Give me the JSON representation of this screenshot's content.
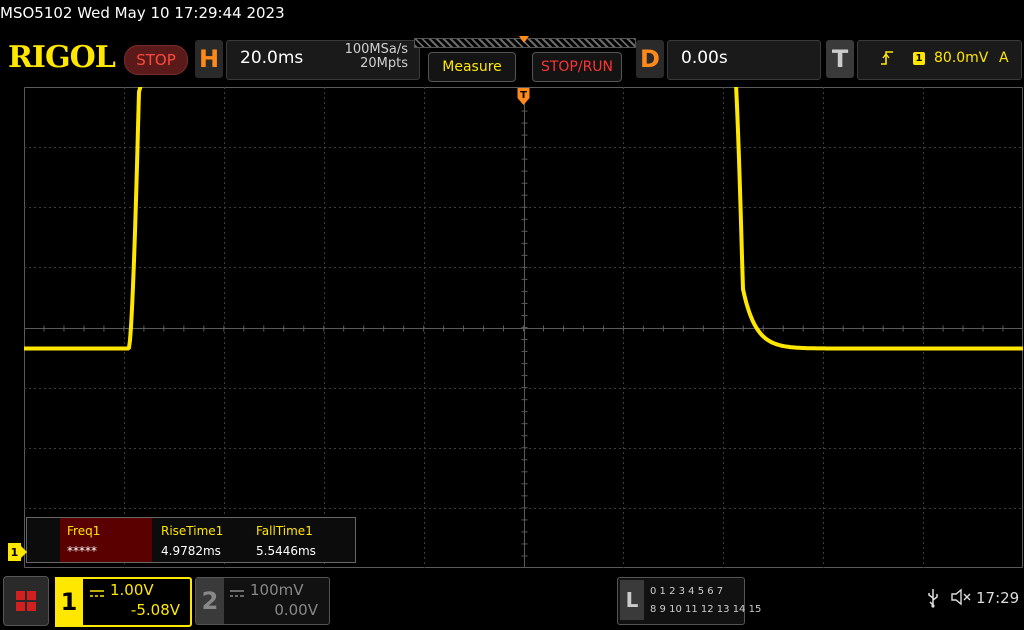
{
  "header": {
    "title_line": "MSO5102  Wed May 10 17:29:44 2023",
    "logo": "RIGOL",
    "run_state": "STOP"
  },
  "horizontal": {
    "letter": "H",
    "timebase": "20.0ms",
    "sample_rate": "100MSa/s",
    "memory_depth": "20Mpts"
  },
  "buttons": {
    "measure": "Measure",
    "stop_run": "STOP/RUN"
  },
  "delay": {
    "letter": "D",
    "value": "0.00s"
  },
  "trigger": {
    "letter": "T",
    "edge_icon": "rising-edge-icon",
    "source": "1",
    "level": "80.0mV",
    "mode": "A"
  },
  "measurements": {
    "headers": [
      "Freq1",
      "RiseTime1",
      "FallTime1"
    ],
    "values": [
      "*****",
      "4.9782ms",
      "5.5446ms"
    ]
  },
  "channels": {
    "ch1": {
      "number": "1",
      "coupling_icon": "dc-coupling-icon",
      "scale": "1.00V",
      "offset": "-5.08V",
      "color": "#ffe700"
    },
    "ch2": {
      "number": "2",
      "coupling_icon": "dc-coupling-icon",
      "scale": "100mV",
      "offset": "0.00V",
      "color": "#888888"
    }
  },
  "logic_analyzer": {
    "letter": "L",
    "row1": "0 1 2 3   4 5 6 7",
    "row2": "8 9 10 11  12 13 14 15"
  },
  "status_bar": {
    "usb_icon": "usb-icon",
    "speaker_icon": "speaker-muted-icon",
    "time": "17:29"
  },
  "colors": {
    "trace": "#ffe700",
    "accent": "#ff8a1a",
    "stop": "#ff3333"
  },
  "waveform": {
    "channel": "1",
    "low_level_div": -0.35,
    "high_level_div": 4.65,
    "rise_start_div": 1.05,
    "rise_time_ms": 4.9782,
    "fall_start_div": 7.1,
    "fall_time_ms": 5.5446,
    "time_per_div_ms": 20.0
  }
}
